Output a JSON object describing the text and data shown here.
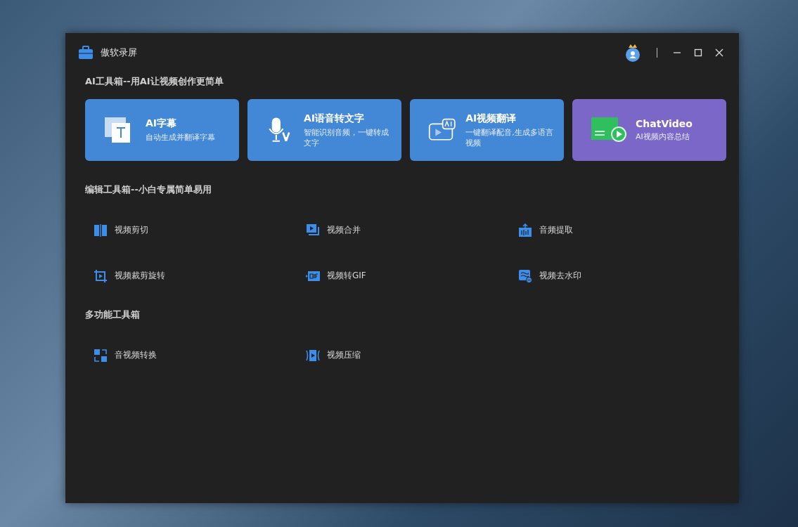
{
  "window": {
    "title": "傲软录屏"
  },
  "sections": [
    {
      "title": "AI工具箱--用AI让视频创作更简单",
      "kind": "cards",
      "cards": [
        {
          "kind": "subtitle",
          "title": "AI字幕",
          "subtitle": "自动生成并翻译字幕",
          "color": "#4388d6"
        },
        {
          "kind": "speech",
          "title": "AI语音转文字",
          "subtitle": "智能识别音频，一键转成文字",
          "color": "#4388d6"
        },
        {
          "kind": "translate",
          "title": "AI视频翻译",
          "subtitle": "一键翻译配音,生成多语言视频",
          "color": "#4388d6"
        },
        {
          "kind": "chat",
          "title": "ChatVideo",
          "subtitle": "AI视频内容总结",
          "color": "#7b67c8"
        }
      ]
    },
    {
      "title": "编辑工具箱--小白专属简单易用",
      "kind": "tools",
      "tools": [
        {
          "kind": "cut",
          "label": "视频剪切"
        },
        {
          "kind": "merge",
          "label": "视频合并"
        },
        {
          "kind": "audio",
          "label": "音频提取"
        },
        {
          "kind": "crop",
          "label": "视频裁剪旋转"
        },
        {
          "kind": "gif",
          "label": "视频转GIF"
        },
        {
          "kind": "watermark",
          "label": "视频去水印"
        }
      ]
    },
    {
      "title": "多功能工具箱",
      "kind": "tools",
      "tools": [
        {
          "kind": "convert",
          "label": "音视频转换"
        },
        {
          "kind": "compress",
          "label": "视频压缩"
        }
      ]
    }
  ]
}
